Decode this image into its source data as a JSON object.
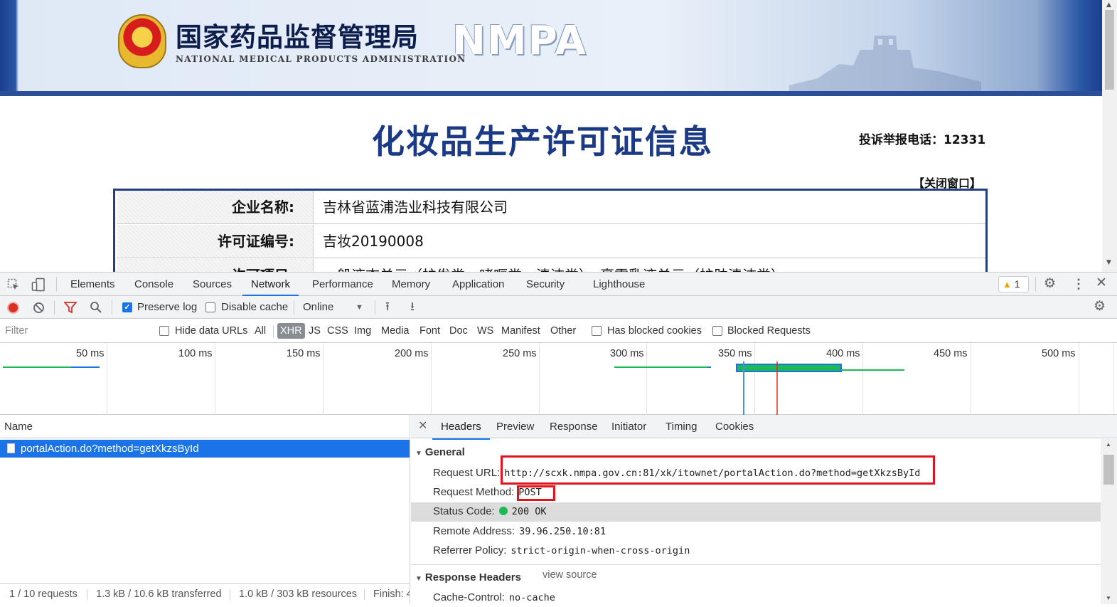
{
  "page": {
    "org_cn": "国家药品监督管理局",
    "org_en": "NATIONAL MEDICAL PRODUCTS ADMINISTRATION",
    "org_abbr": "NMPA",
    "title": "化妆品生产许可证信息",
    "hotline": "投诉举报电话：12331",
    "close_window": "【关闭窗口】",
    "rows": [
      {
        "label": "企业名称:",
        "value": "吉林省蓝浦浩业科技有限公司"
      },
      {
        "label": "许可证编号:",
        "value": "吉妆20190008"
      },
      {
        "label": "许可项目:",
        "value": "一般液态单元（护发类、啫喱类、清洁类），膏霜乳液单元（护肤清洁类）"
      }
    ]
  },
  "devtools": {
    "tabs": [
      "Elements",
      "Console",
      "Sources",
      "Network",
      "Performance",
      "Memory",
      "Application",
      "Security",
      "Lighthouse"
    ],
    "active_tab": "Network",
    "warnings": "1",
    "toolbar": {
      "preserve_log": "Preserve log",
      "disable_cache": "Disable cache",
      "throttle": "Online"
    },
    "filter": {
      "placeholder": "Filter",
      "hide_data_urls": "Hide data URLs",
      "types": [
        "All",
        "XHR",
        "JS",
        "CSS",
        "Img",
        "Media",
        "Font",
        "Doc",
        "WS",
        "Manifest",
        "Other"
      ],
      "active_type": "XHR",
      "has_blocked_cookies": "Has blocked cookies",
      "blocked_requests": "Blocked Requests"
    },
    "timeline": {
      "labels": [
        "50 ms",
        "100 ms",
        "150 ms",
        "200 ms",
        "250 ms",
        "300 ms",
        "350 ms",
        "400 ms",
        "450 ms",
        "500 ms"
      ]
    },
    "requests": {
      "column": "Name",
      "items": [
        "portalAction.do?method=getXkzsById"
      ],
      "status": [
        "1 / 10 requests",
        "1.3 kB / 10.6 kB transferred",
        "1.0 kB / 303 kB resources",
        "Finish: 4"
      ]
    },
    "detail": {
      "tabs": [
        "Headers",
        "Preview",
        "Response",
        "Initiator",
        "Timing",
        "Cookies"
      ],
      "active_tab": "Headers",
      "general_title": "General",
      "request_url_label": "Request URL:",
      "request_url": "http://scxk.nmpa.gov.cn:81/xk/itownet/portalAction.do?method=getXkzsById",
      "request_method_label": "Request Method:",
      "request_method": "POST",
      "status_code_label": "Status Code:",
      "status_code": "200 OK",
      "remote_address_label": "Remote Address:",
      "remote_address": "39.96.250.10:81",
      "referrer_policy_label": "Referrer Policy:",
      "referrer_policy": "strict-origin-when-cross-origin",
      "response_headers_title": "Response Headers",
      "view_source": "view source",
      "cache_control_label": "Cache-Control:",
      "cache_control": "no-cache"
    }
  },
  "colors": {
    "accent": "#1a73e8",
    "highlight_box": "#e0141e",
    "title_blue": "#1b3a86",
    "status_green": "#1db954"
  }
}
